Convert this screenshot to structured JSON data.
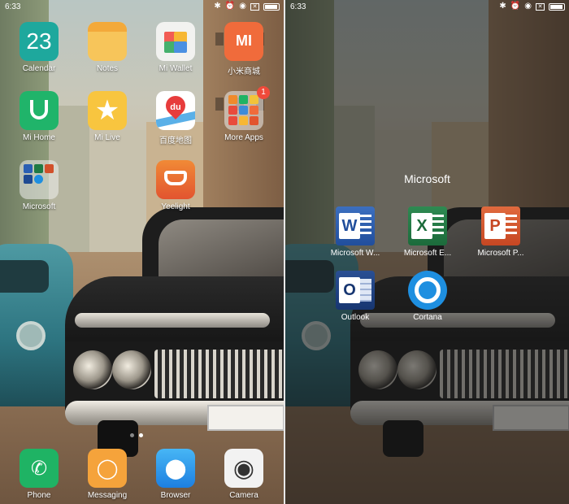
{
  "colors": {
    "calendar": "#1ea89d",
    "notes": "#f7c55a",
    "mi_store": "#f06b3b",
    "mi_home": "#20b46a",
    "yeelight": "#e2542f",
    "badge": "#f04a3a",
    "word": "#214e9c",
    "excel": "#1c6b3b",
    "powerpoint": "#c74723",
    "outlook": "#173671",
    "cortana": "#1e8fe0"
  },
  "left_screen": {
    "status": {
      "time": "6:33",
      "icons": [
        "bluetooth-icon",
        "alarm-icon",
        "wifi-icon",
        "sim-icon",
        "battery-icon"
      ]
    },
    "calendar_day": "23",
    "apps": [
      {
        "label": "Calendar",
        "icon": "calendar-icon"
      },
      {
        "label": "Notes",
        "icon": "notes-icon"
      },
      {
        "label": "Mi Wallet",
        "icon": "wallet-icon"
      },
      {
        "label": "小米商城",
        "icon": "mi-store-icon"
      },
      {
        "label": "Mi Home",
        "icon": "mi-home-icon"
      },
      {
        "label": "Mi Live",
        "icon": "mi-live-icon"
      },
      {
        "label": "百度地图",
        "icon": "baidu-map-icon"
      },
      {
        "label": "More Apps",
        "icon": "folder-icon",
        "badge": "1"
      },
      {
        "label": "Microsoft",
        "icon": "folder-icon"
      },
      {
        "label": "Yeelight",
        "icon": "yeelight-icon"
      }
    ],
    "mi_store_mark": "MI",
    "map_mark": "du",
    "page_indicator": {
      "pages": 2,
      "current": 2
    },
    "dock": [
      {
        "label": "Phone",
        "icon": "phone-icon"
      },
      {
        "label": "Messaging",
        "icon": "messaging-icon"
      },
      {
        "label": "Browser",
        "icon": "browser-icon"
      },
      {
        "label": "Camera",
        "icon": "camera-icon"
      }
    ]
  },
  "right_screen": {
    "status": {
      "time": "6:33"
    },
    "folder_title": "Microsoft",
    "apps": [
      {
        "label": "Microsoft W...",
        "icon": "word-icon",
        "letter": "W"
      },
      {
        "label": "Microsoft E...",
        "icon": "excel-icon",
        "letter": "X"
      },
      {
        "label": "Microsoft P...",
        "icon": "powerpoint-icon",
        "letter": "P"
      },
      {
        "label": "Outlook",
        "icon": "outlook-icon",
        "letter": "O"
      },
      {
        "label": "Cortana",
        "icon": "cortana-icon"
      }
    ]
  }
}
